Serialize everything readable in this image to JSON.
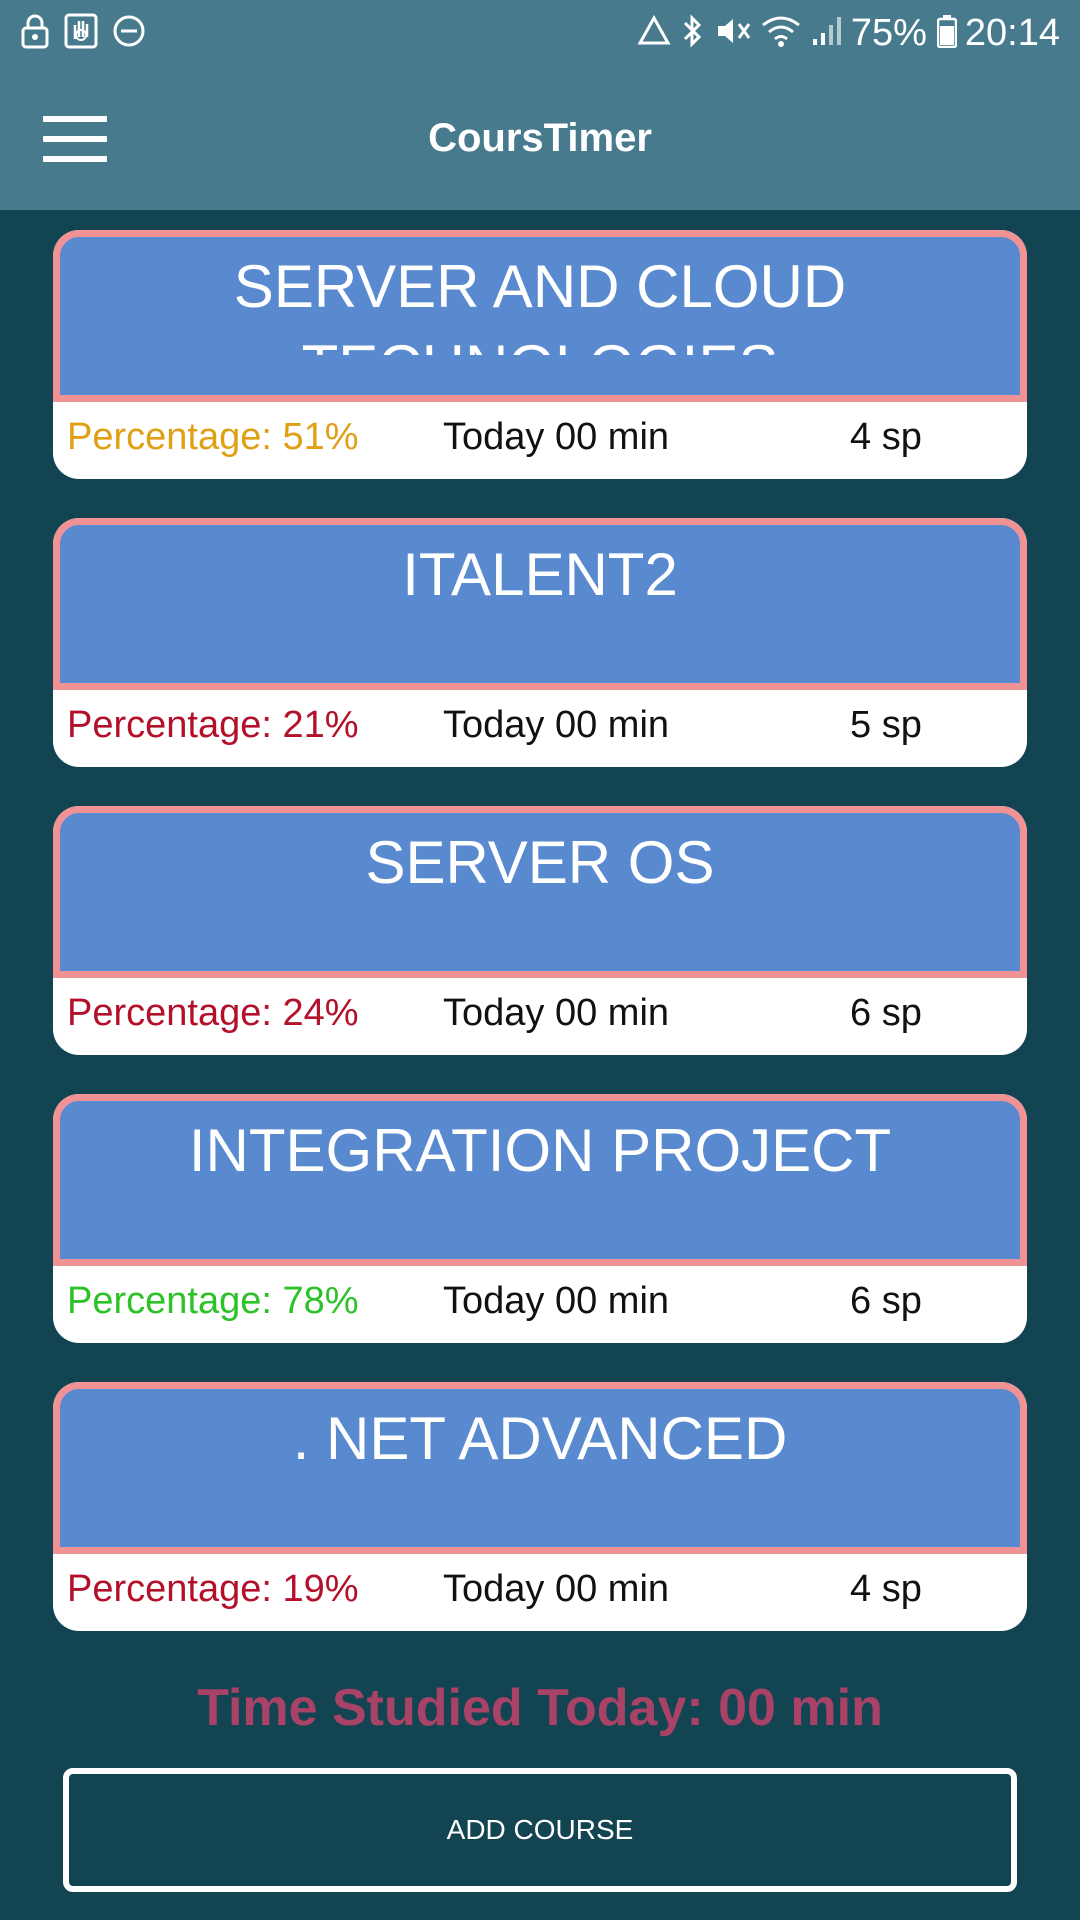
{
  "status_bar": {
    "battery": "75%",
    "time": "20:14",
    "icons_left": [
      "lock-icon",
      "hand-icon",
      "dnd-icon"
    ],
    "icons_right": [
      "recycle-icon",
      "bluetooth-icon",
      "mute-icon",
      "wifi-icon",
      "signal-icon",
      "battery-icon"
    ]
  },
  "app_bar": {
    "title": "CoursTimer",
    "menu_icon": "hamburger-menu-icon"
  },
  "courses": [
    {
      "name": "SERVER AND CLOUD TECHNOLOGIES",
      "percentage": "Percentage: 51%",
      "today": "Today 00 min",
      "sp": "4 sp",
      "percentage_color": "#e0a016"
    },
    {
      "name": "ITALENT2",
      "percentage": "Percentage: 21%",
      "today": "Today 00 min",
      "sp": "5 sp",
      "percentage_color": "#b3102b"
    },
    {
      "name": "SERVER OS",
      "percentage": "Percentage: 24%",
      "today": "Today 00 min",
      "sp": "6 sp",
      "percentage_color": "#b3102b"
    },
    {
      "name": "INTEGRATION PROJECT",
      "percentage": "Percentage: 78%",
      "today": "Today 00 min",
      "sp": "6 sp",
      "percentage_color": "#2cc228"
    },
    {
      "name": ". NET ADVANCED",
      "percentage": "Percentage: 19%",
      "today": "Today 00 min",
      "sp": "4 sp",
      "percentage_color": "#b3102b"
    }
  ],
  "summary": {
    "time_studied": "Time Studied Today: 00 min"
  },
  "actions": {
    "add_course_label": "ADD COURSE"
  },
  "colors": {
    "background": "#134452",
    "app_bar": "#467a8c",
    "card_header": "#5989cf",
    "card_border": "#f19294",
    "time_studied": "#a84266"
  }
}
